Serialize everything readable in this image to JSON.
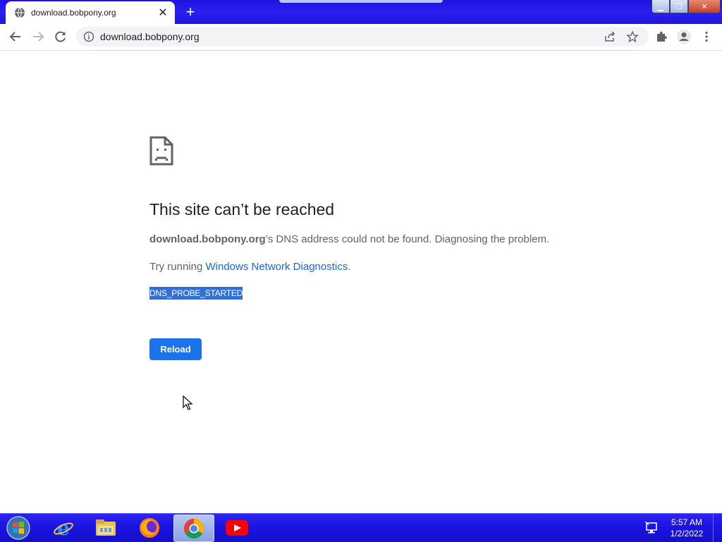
{
  "browser": {
    "tab": {
      "title": "download.bobpony.org",
      "favicon": "globe-icon",
      "close": "close-icon"
    },
    "new_tab": "plus-icon",
    "window_controls": [
      "minimize-icon",
      "maximize-icon",
      "close-icon"
    ],
    "toolbar": {
      "back": "arrow-left-icon",
      "forward": "arrow-right-icon",
      "reload": "reload-icon",
      "omnibox": {
        "url": "download.bobpony.org",
        "site_info": "info-icon",
        "share": "share-icon",
        "bookmark": "star-icon"
      },
      "extensions": "puzzle-icon",
      "profile": "person-icon",
      "menu": "kebab-menu-icon"
    }
  },
  "error_page": {
    "icon": "sad-page-icon",
    "title": "This site can’t be reached",
    "host": "download.bobpony.org",
    "desc_rest": "’s DNS address could not be found. Diagnosing the problem.",
    "suggest_prefix": "Try running ",
    "suggest_link": "Windows Network Diagnostics",
    "suggest_suffix": ".",
    "error_code": "DNS_PROBE_STARTED",
    "reload_label": "Reload"
  },
  "taskbar": {
    "start": "windows-start-icon",
    "items": [
      {
        "name": "internet-explorer-icon",
        "active": false
      },
      {
        "name": "file-explorer-icon",
        "active": false
      },
      {
        "name": "firefox-icon",
        "active": false
      },
      {
        "name": "chrome-icon",
        "active": true
      },
      {
        "name": "youtube-icon",
        "active": false
      }
    ],
    "tray_icon": "network-icon",
    "time": "5:57 AM",
    "date": "1/2/2022"
  },
  "colors": {
    "taskbar": "#1a12e0",
    "titlebar": "#2a1ff0",
    "link": "#1967d2",
    "button": "#1a73e8",
    "selection": "#2f6fd6"
  }
}
